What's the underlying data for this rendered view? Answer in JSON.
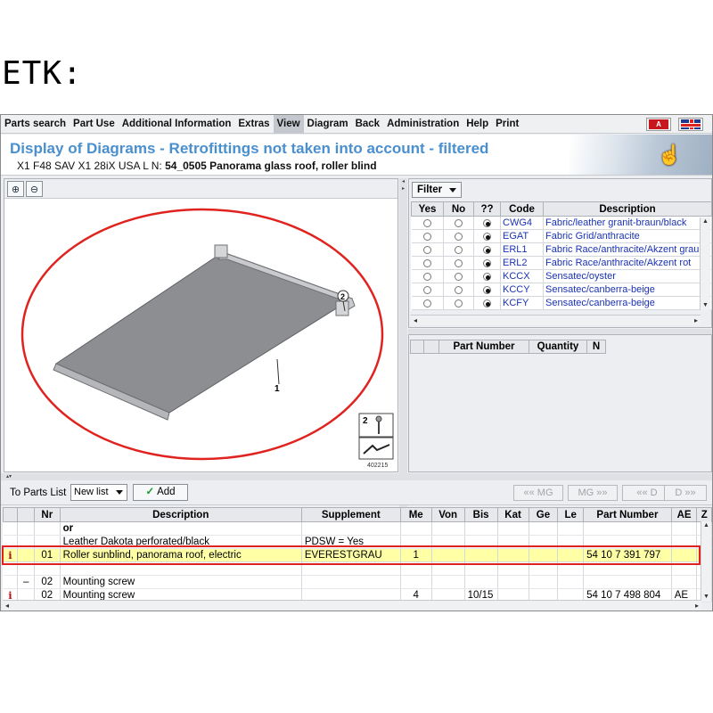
{
  "caption": "ETK:",
  "menu": {
    "items": [
      "Parts search",
      "Part Use",
      "Additional Information",
      "Extras",
      "View",
      "Diagram",
      "Back",
      "Administration",
      "Help",
      "Print"
    ],
    "active_index": 4,
    "flag_a_label": "A"
  },
  "header": {
    "title": "Display of Diagrams - Retrofittings not taken into account - filtered",
    "vehicle": "X1 F48 SAV X1 28iX USA  L N:",
    "group": "54_0505 Panorama glass roof, roller blind"
  },
  "diagram": {
    "callout_1": "1",
    "callout_2": "2",
    "legend_2": "2",
    "image_id": "402215"
  },
  "filter": {
    "button_label": "Filter",
    "columns": [
      "Yes",
      "No",
      "??",
      "Code",
      "Description"
    ],
    "rows": [
      {
        "code": "CWG4",
        "description": "Fabric/leather granit-braun/black",
        "selected": "??"
      },
      {
        "code": "EGAT",
        "description": "Fabric Grid/anthracite",
        "selected": "??"
      },
      {
        "code": "ERL1",
        "description": "Fabric Race/anthracite/Akzent grau",
        "selected": "??"
      },
      {
        "code": "ERL2",
        "description": "Fabric Race/anthracite/Akzent rot",
        "selected": "??"
      },
      {
        "code": "KCCX",
        "description": "Sensatec/oyster",
        "selected": "??"
      },
      {
        "code": "KCCY",
        "description": "Sensatec/canberra-beige",
        "selected": "??"
      },
      {
        "code": "KCFY",
        "description": "Sensatec/canberra-beige",
        "selected": "??"
      }
    ]
  },
  "partnumber_panel": {
    "columns": [
      "",
      "",
      "Part Number",
      "Quantity",
      "N"
    ]
  },
  "toolbar": {
    "to_parts_list": "To Parts List",
    "list_select": "New list",
    "add_label": "Add",
    "nav": [
      "«« MG",
      "MG »»",
      "«« D",
      "D »»"
    ]
  },
  "parts": {
    "columns": [
      "",
      "",
      "Nr",
      "Description",
      "Supplement",
      "Me",
      "Von",
      "Bis",
      "Kat",
      "Ge",
      "Le",
      "Part Number",
      "AE",
      "Z"
    ],
    "rows": [
      {
        "info": "",
        "mark": "",
        "nr": "",
        "description": "or",
        "supplement": "",
        "me": "",
        "von": "",
        "bis": "",
        "kat": "",
        "ge": "",
        "le": "",
        "part_number": "",
        "ae": "",
        "z": "",
        "bold": true
      },
      {
        "info": "",
        "mark": "",
        "nr": "",
        "description": "Leather Dakota perforated/black",
        "supplement": "PDSW = Yes",
        "me": "",
        "von": "",
        "bis": "",
        "kat": "",
        "ge": "",
        "le": "",
        "part_number": "",
        "ae": "",
        "z": "",
        "bold": false
      },
      {
        "info": "i",
        "mark": "",
        "nr": "01",
        "description": "Roller sunblind, panorama roof, electric",
        "supplement": "EVERESTGRAU",
        "me": "1",
        "von": "",
        "bis": "",
        "kat": "",
        "ge": "",
        "le": "",
        "part_number": "54 10 7 391 797",
        "ae": "",
        "z": "",
        "bold": false,
        "highlight": true
      },
      {
        "info": "",
        "mark": "",
        "nr": "",
        "description": "",
        "supplement": "",
        "me": "",
        "von": "",
        "bis": "",
        "kat": "",
        "ge": "",
        "le": "",
        "part_number": "",
        "ae": "",
        "z": "",
        "bold": false
      },
      {
        "info": "",
        "mark": "–",
        "nr": "02",
        "description": "Mounting screw",
        "supplement": "",
        "me": "",
        "von": "",
        "bis": "",
        "kat": "",
        "ge": "",
        "le": "",
        "part_number": "",
        "ae": "",
        "z": "",
        "bold": false
      },
      {
        "info": "i",
        "mark": "",
        "nr": "02",
        "description": "Mounting screw",
        "supplement": "",
        "me": "4",
        "von": "",
        "bis": "10/15",
        "kat": "",
        "ge": "",
        "le": "",
        "part_number": "54 10 7 498 804",
        "ae": "AE",
        "z": "",
        "bold": false
      }
    ]
  }
}
